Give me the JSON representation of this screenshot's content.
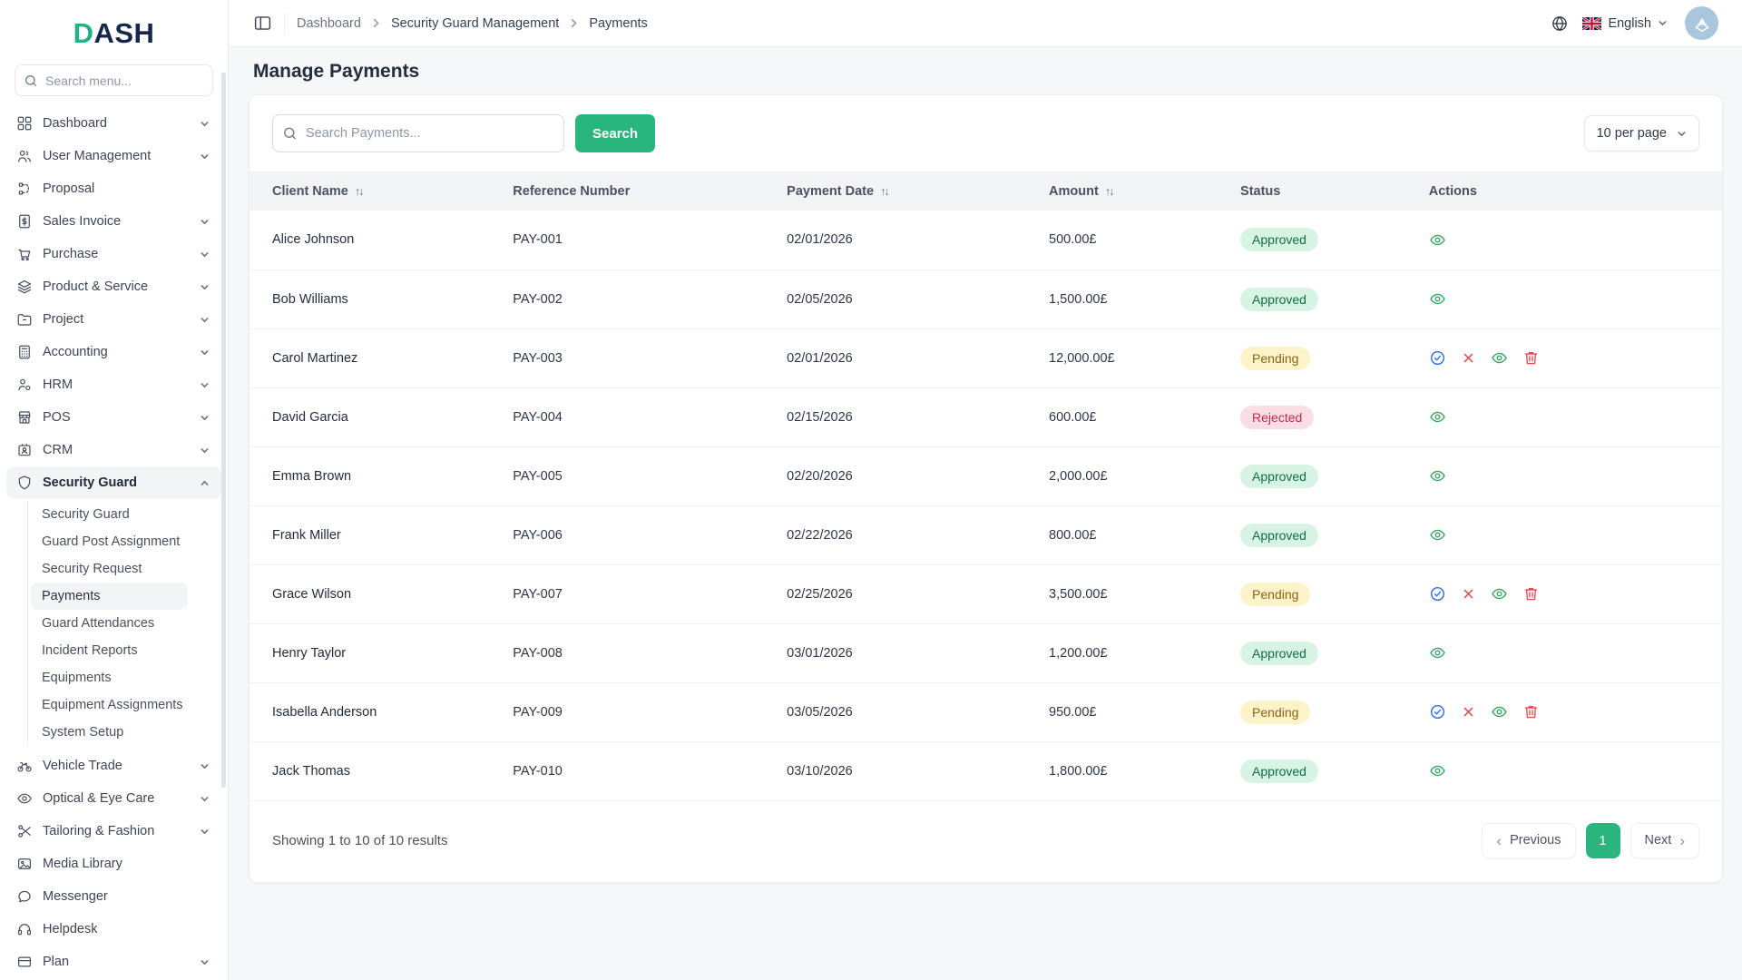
{
  "brand": {
    "logo_accent": "D",
    "logo_rest": "ASH"
  },
  "sidebar": {
    "search_placeholder": "Search menu...",
    "items": [
      {
        "label": "Dashboard",
        "icon": "grid",
        "chevron": true
      },
      {
        "label": "User Management",
        "icon": "users",
        "chevron": true
      },
      {
        "label": "Proposal",
        "icon": "proposal",
        "chevron": false
      },
      {
        "label": "Sales Invoice",
        "icon": "invoice",
        "chevron": true
      },
      {
        "label": "Purchase",
        "icon": "cart",
        "chevron": true
      },
      {
        "label": "Product & Service",
        "icon": "layers",
        "chevron": true
      },
      {
        "label": "Project",
        "icon": "folder",
        "chevron": true
      },
      {
        "label": "Accounting",
        "icon": "calculator",
        "chevron": true
      },
      {
        "label": "HRM",
        "icon": "people",
        "chevron": true
      },
      {
        "label": "POS",
        "icon": "store",
        "chevron": true
      },
      {
        "label": "CRM",
        "icon": "contact-card",
        "chevron": true
      },
      {
        "label": "Security Guard",
        "icon": "shield",
        "chevron": true,
        "expanded": true,
        "active": true,
        "submenu": [
          "Security Guard",
          "Guard Post Assignment",
          "Security Request",
          "Payments",
          "Guard Attendances",
          "Incident Reports",
          "Equipments",
          "Equipment Assignments",
          "System Setup"
        ],
        "active_submenu": "Payments"
      },
      {
        "label": "Vehicle Trade",
        "icon": "bike",
        "chevron": true
      },
      {
        "label": "Optical & Eye Care",
        "icon": "eye",
        "chevron": true
      },
      {
        "label": "Tailoring & Fashion",
        "icon": "scissors",
        "chevron": true
      },
      {
        "label": "Media Library",
        "icon": "image",
        "chevron": false
      },
      {
        "label": "Messenger",
        "icon": "chat",
        "chevron": false
      },
      {
        "label": "Helpdesk",
        "icon": "headset",
        "chevron": false
      },
      {
        "label": "Plan",
        "icon": "card",
        "chevron": true
      }
    ]
  },
  "header": {
    "breadcrumb": [
      "Dashboard",
      "Security Guard Management",
      "Payments"
    ],
    "language": "English"
  },
  "page": {
    "title": "Manage Payments",
    "search_placeholder": "Search Payments...",
    "search_button": "Search",
    "per_page": "10 per page"
  },
  "table": {
    "columns": [
      {
        "label": "Client Name",
        "sortable": true
      },
      {
        "label": "Reference Number",
        "sortable": false
      },
      {
        "label": "Payment Date",
        "sortable": true
      },
      {
        "label": "Amount",
        "sortable": true
      },
      {
        "label": "Status",
        "sortable": false
      },
      {
        "label": "Actions",
        "sortable": false
      }
    ],
    "rows": [
      {
        "client": "Alice Johnson",
        "ref": "PAY-001",
        "date": "02/01/2026",
        "amount": "500.00£",
        "status": "Approved",
        "actions": [
          "view"
        ]
      },
      {
        "client": "Bob Williams",
        "ref": "PAY-002",
        "date": "02/05/2026",
        "amount": "1,500.00£",
        "status": "Approved",
        "actions": [
          "view"
        ]
      },
      {
        "client": "Carol Martinez",
        "ref": "PAY-003",
        "date": "02/01/2026",
        "amount": "12,000.00£",
        "status": "Pending",
        "actions": [
          "approve",
          "reject",
          "view",
          "delete"
        ]
      },
      {
        "client": "David Garcia",
        "ref": "PAY-004",
        "date": "02/15/2026",
        "amount": "600.00£",
        "status": "Rejected",
        "actions": [
          "view"
        ]
      },
      {
        "client": "Emma Brown",
        "ref": "PAY-005",
        "date": "02/20/2026",
        "amount": "2,000.00£",
        "status": "Approved",
        "actions": [
          "view"
        ]
      },
      {
        "client": "Frank Miller",
        "ref": "PAY-006",
        "date": "02/22/2026",
        "amount": "800.00£",
        "status": "Approved",
        "actions": [
          "view"
        ]
      },
      {
        "client": "Grace Wilson",
        "ref": "PAY-007",
        "date": "02/25/2026",
        "amount": "3,500.00£",
        "status": "Pending",
        "actions": [
          "approve",
          "reject",
          "view",
          "delete"
        ]
      },
      {
        "client": "Henry Taylor",
        "ref": "PAY-008",
        "date": "03/01/2026",
        "amount": "1,200.00£",
        "status": "Approved",
        "actions": [
          "view"
        ]
      },
      {
        "client": "Isabella Anderson",
        "ref": "PAY-009",
        "date": "03/05/2026",
        "amount": "950.00£",
        "status": "Pending",
        "actions": [
          "approve",
          "reject",
          "view",
          "delete"
        ]
      },
      {
        "client": "Jack Thomas",
        "ref": "PAY-010",
        "date": "03/10/2026",
        "amount": "1,800.00£",
        "status": "Approved",
        "actions": [
          "view"
        ]
      }
    ]
  },
  "footer": {
    "summary": "Showing 1 to 10 of 10 results",
    "previous": "Previous",
    "page": "1",
    "next": "Next"
  },
  "colors": {
    "accent_green": "#2ab57d",
    "logo_green": "#21b286",
    "logo_navy": "#15284b",
    "approved_bg": "#d7f3e4",
    "approved_text": "#136c47",
    "pending_bg": "#fcf3c8",
    "pending_text": "#8b6414",
    "rejected_bg": "#fcdde4",
    "rejected_text": "#c02a52",
    "view_icon": "#37a35e",
    "approve_icon": "#2f6fed",
    "danger_icon": "#e5484d",
    "avatar_bg": "#a9c6dc"
  }
}
